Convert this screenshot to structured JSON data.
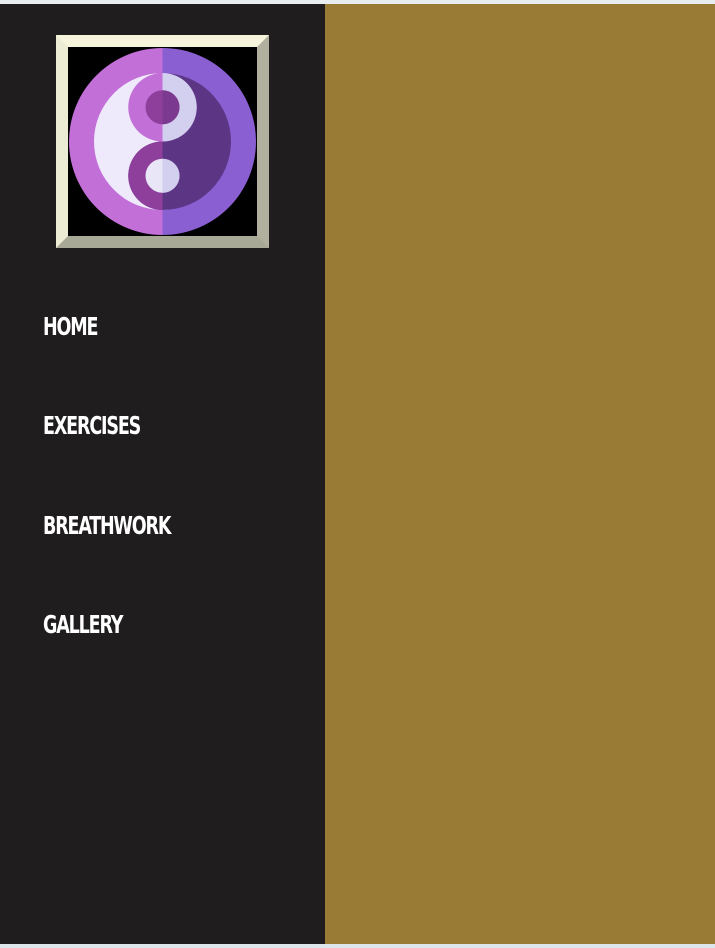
{
  "logo": {
    "icon": "yin-yang-icon",
    "colors": {
      "frame": "#f7f4dc",
      "left_half": "#c36fd8",
      "right_half": "#8a5fd2",
      "light": "#eeeafb",
      "dark": "#5d3585"
    }
  },
  "nav": {
    "items": [
      {
        "label": "HOME"
      },
      {
        "label": "EXERCISES"
      },
      {
        "label": "BREATHWORK"
      },
      {
        "label": "GALLERY"
      }
    ]
  },
  "theme": {
    "sidebar_bg": "#1f1d1e",
    "main_bg": "#9a7b35",
    "nav_text": "#ffffff"
  }
}
